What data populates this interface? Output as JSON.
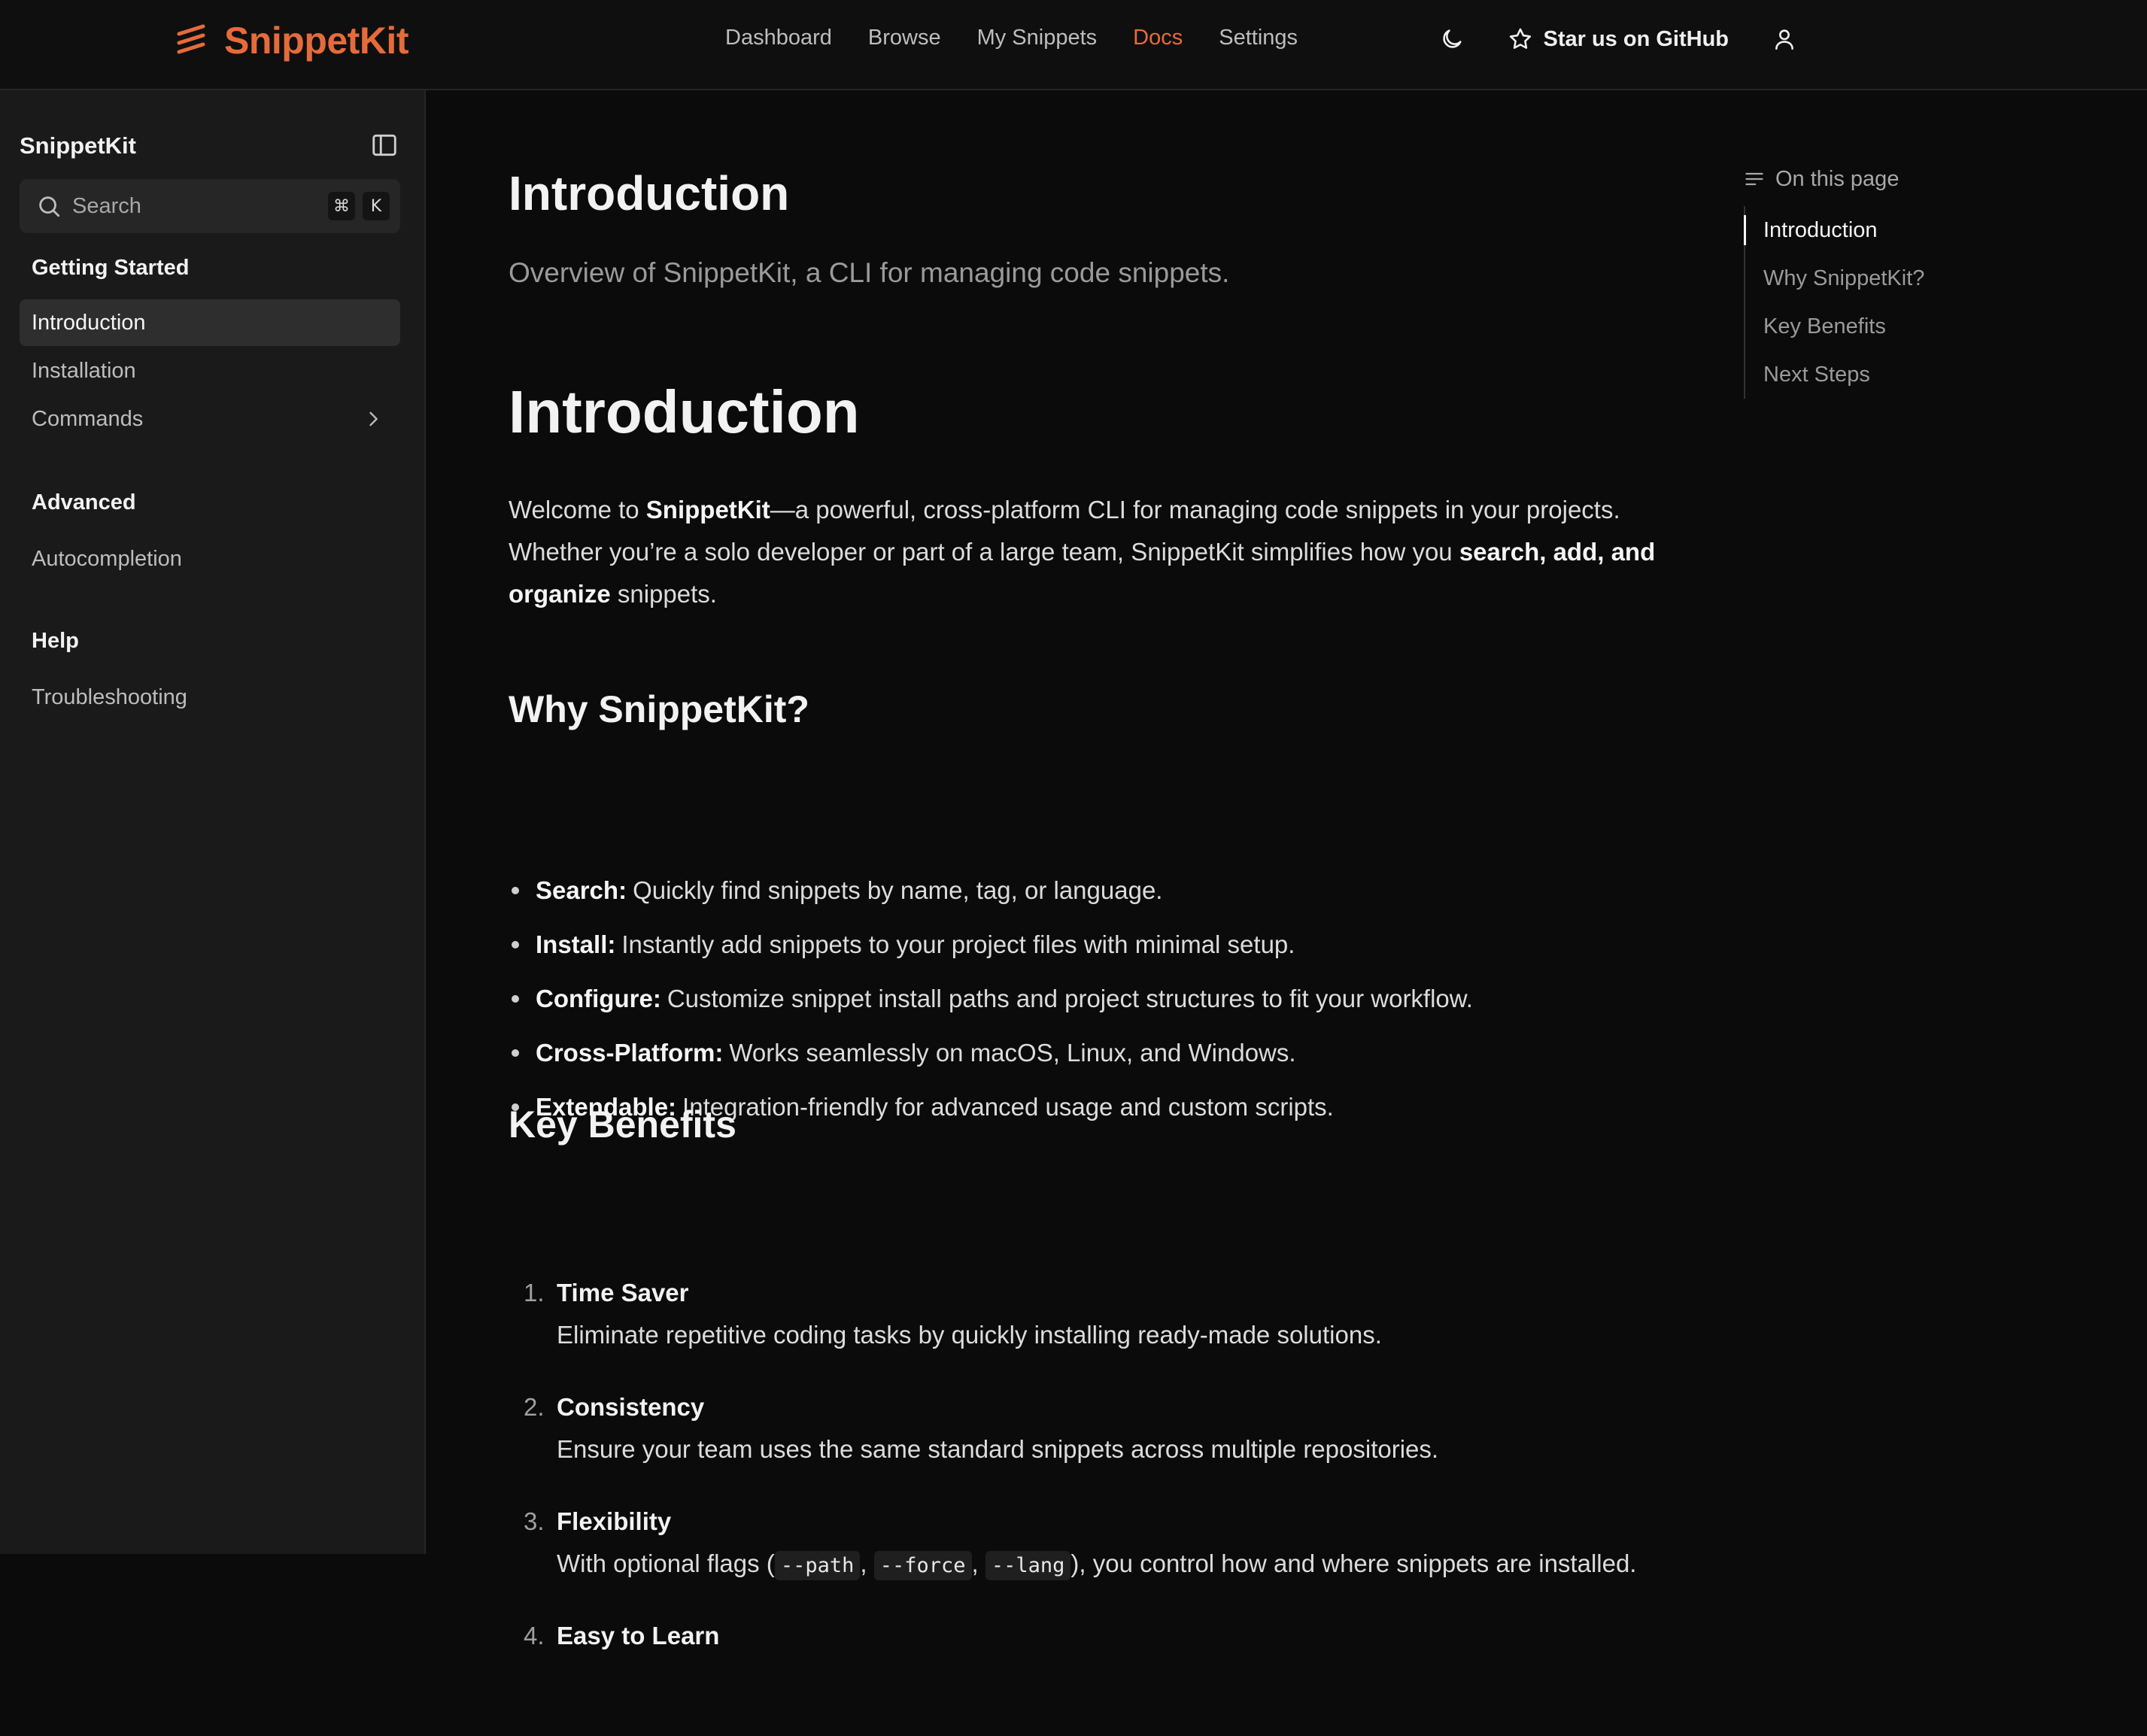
{
  "brand": {
    "name": "SnippetKit",
    "color": "#e66b3a"
  },
  "nav": {
    "links": [
      "Dashboard",
      "Browse",
      "My Snippets",
      "Docs",
      "Settings"
    ],
    "active": "Docs",
    "github_label": "Star us on GitHub",
    "icons": [
      "moon-icon",
      "star-icon",
      "user-icon"
    ]
  },
  "sidebar": {
    "title": "SnippetKit",
    "search_placeholder": "Search",
    "shortcut_keys": [
      "⌘",
      "K"
    ],
    "groups": [
      {
        "title": "Getting Started",
        "items": [
          "Introduction",
          "Installation",
          "Commands"
        ]
      },
      {
        "title": "Advanced",
        "items": [
          "Autocompletion"
        ]
      },
      {
        "title": "Help",
        "items": [
          "Troubleshooting"
        ]
      }
    ],
    "active_item": "Introduction"
  },
  "main": {
    "page_title": "Introduction",
    "page_subtitle": "Overview of SnippetKit, a CLI for managing code snippets.",
    "heading": "Introduction",
    "intro": {
      "p1": "Welcome to ",
      "b1": "SnippetKit",
      "p2": "—a powerful, cross-platform CLI for managing code snippets in your projects. Whether you’re a solo developer or part of a large team, SnippetKit simplifies how you ",
      "b2": "search, add, and organize",
      "p3": " snippets."
    },
    "why_heading": "Why SnippetKit?",
    "why_items": [
      {
        "label": "Search:",
        "text": "Quickly find snippets by name, tag, or language."
      },
      {
        "label": "Install:",
        "text": "Instantly add snippets to your project files with minimal setup."
      },
      {
        "label": "Configure:",
        "text": "Customize snippet install paths and project structures to fit your workflow."
      },
      {
        "label": "Cross-Platform:",
        "text": "Works seamlessly on macOS, Linux, and Windows."
      },
      {
        "label": "Extendable:",
        "text": "Integration-friendly for advanced usage and custom scripts."
      }
    ],
    "benefits_heading": "Key Benefits",
    "benefits": [
      {
        "num": "1.",
        "title": "Time Saver",
        "desc": "Eliminate repetitive coding tasks by quickly installing ready-made solutions."
      },
      {
        "num": "2.",
        "title": "Consistency",
        "desc": "Ensure your team uses the same standard snippets across multiple repositories."
      },
      {
        "num": "3.",
        "title": "Flexibility",
        "desc_pre": "With optional flags (",
        "flags": [
          "--path",
          "--force",
          "--lang"
        ],
        "sep": ", ",
        "desc_post": "), you control how and where snippets are installed."
      },
      {
        "num": "4.",
        "title": "Easy to Learn"
      }
    ]
  },
  "toc": {
    "heading": "On this page",
    "items": [
      "Introduction",
      "Why SnippetKit?",
      "Key Benefits",
      "Next Steps"
    ],
    "active": "Introduction"
  }
}
